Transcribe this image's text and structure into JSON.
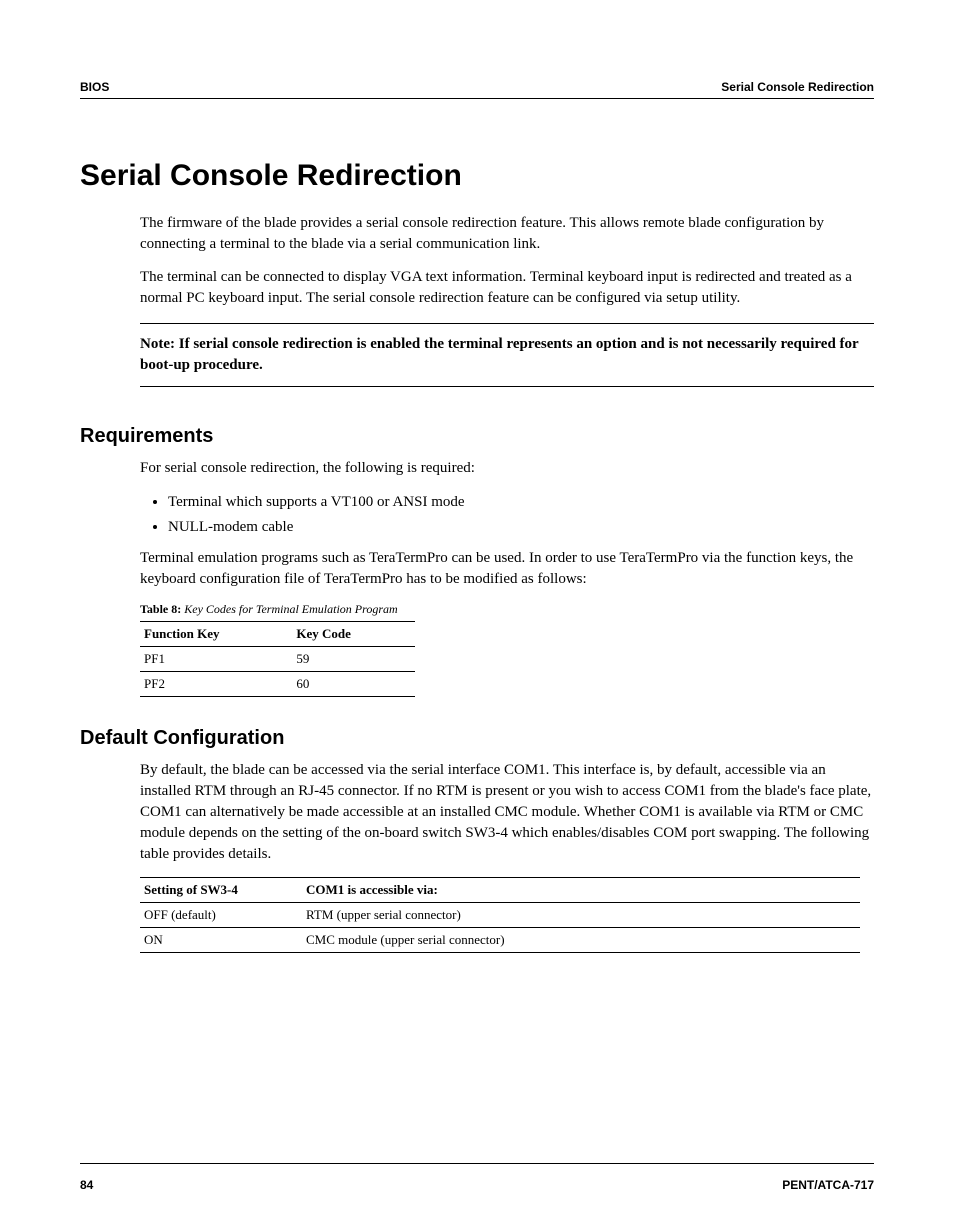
{
  "header": {
    "left": "BIOS",
    "right": "Serial Console Redirection"
  },
  "title": "Serial Console Redirection",
  "intro": {
    "p1": "The firmware of the blade provides a serial console redirection feature. This allows remote blade configuration by connecting a terminal to the blade via a serial communication link.",
    "p2": "The terminal can be connected to display VGA text information. Terminal keyboard input is redirected and treated as a normal PC keyboard input. The serial console redirection feature can be configured via setup utility."
  },
  "note": "Note:  If serial console redirection is enabled the terminal represents an option and is not necessarily required for boot-up procedure.",
  "requirements": {
    "heading": "Requirements",
    "lead": "For serial console redirection, the following is required:",
    "items": [
      "Terminal which supports a VT100 or ANSI mode",
      "NULL-modem cable"
    ],
    "after": "Terminal emulation programs such as TeraTermPro can be used. In order to use TeraTermPro via the function keys, the keyboard configuration file of TeraTermPro has to be modified as follows:",
    "table_caption_bold": "Table 8:",
    "table_caption_italic": " Key Codes for Terminal Emulation Program",
    "table_headers": [
      "Function Key",
      "Key Code"
    ],
    "table_rows": [
      [
        "PF1",
        "59"
      ],
      [
        "PF2",
        "60"
      ]
    ]
  },
  "default_config": {
    "heading": "Default Configuration",
    "p1": "By default, the blade can be accessed via the serial interface COM1. This interface is, by default, accessible via an installed RTM through an RJ-45 connector. If no RTM is present or you wish to access COM1 from the blade's face plate, COM1 can alternatively be made accessible at an installed CMC module. Whether COM1 is available via RTM or CMC module depends on the setting of the on-board switch SW3-4 which enables/disables COM port swapping. The following table provides details.",
    "table_headers": [
      "Setting of SW3-4",
      "COM1 is accessible via:"
    ],
    "table_rows": [
      [
        "OFF (default)",
        "RTM (upper serial connector)"
      ],
      [
        "ON",
        "CMC module (upper serial connector)"
      ]
    ]
  },
  "footer": {
    "page": "84",
    "doc": "PENT/ATCA-717"
  }
}
